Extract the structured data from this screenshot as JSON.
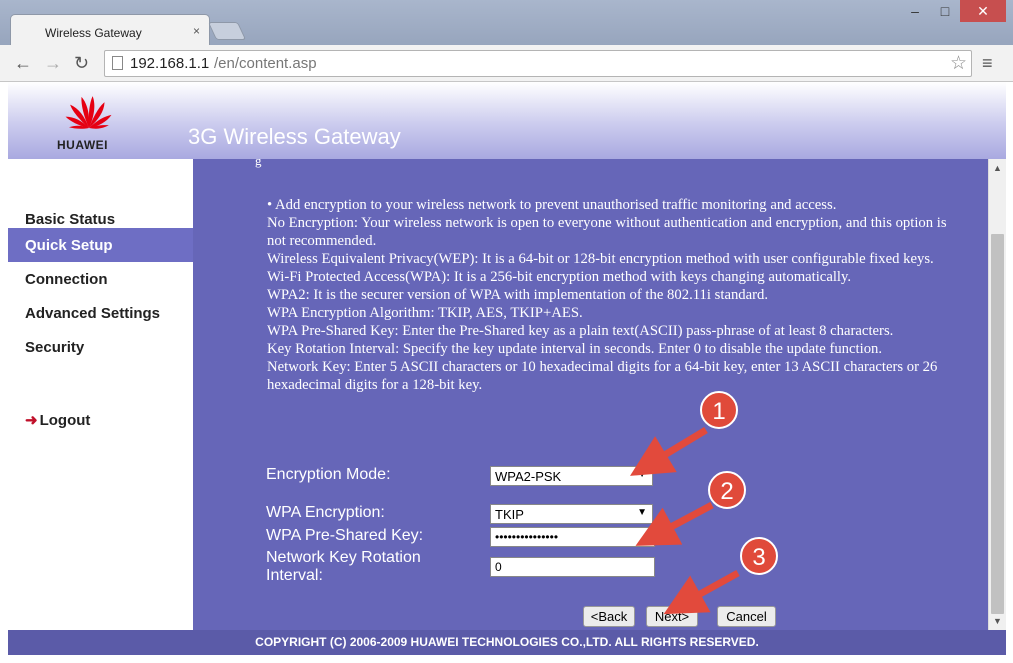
{
  "browser": {
    "tab_title": "Wireless Gateway",
    "tab_close": "×",
    "url_host": "192.168.1.1",
    "url_path": "/en/content.asp",
    "back": "←",
    "forward": "→",
    "reload": "↻",
    "star": "☆",
    "menu": "≡",
    "min": "–",
    "max": "□",
    "close": "✕"
  },
  "header": {
    "brand": "HUAWEI",
    "title": "3G Wireless Gateway",
    "partial_heading": "g"
  },
  "sidebar": {
    "items": [
      {
        "label": "Basic Status"
      },
      {
        "label": "Quick Setup"
      },
      {
        "label": "Connection"
      },
      {
        "label": "Advanced Settings"
      },
      {
        "label": "Security"
      }
    ],
    "logout": "Logout"
  },
  "info": {
    "lines": [
      "• Add encryption to your wireless network to prevent unauthorised traffic monitoring and access.",
      "No Encryption: Your wireless network is open to everyone without authentication and encryption, and this option is not recommended.",
      "Wireless Equivalent Privacy(WEP): It is a 64-bit or 128-bit encryption method with user configurable fixed keys.",
      "Wi-Fi Protected Access(WPA): It is a 256-bit encryption method with keys changing automatically.",
      "WPA2: It is the securer version of WPA with implementation of the 802.11i standard.",
      "WPA Encryption Algorithm: TKIP, AES, TKIP+AES.",
      "WPA Pre-Shared Key: Enter the Pre-Shared key as a plain text(ASCII) pass-phrase of at least 8 characters.",
      "Key Rotation Interval: Specify the key update interval in seconds. Enter 0 to disable the update function.",
      "Network Key: Enter 5 ASCII characters or 10 hexadecimal digits for a 64-bit key, enter 13 ASCII characters or 26 hexadecimal digits for a 128-bit key."
    ]
  },
  "form": {
    "encryption_mode_label": "Encryption Mode:",
    "encryption_mode_value": "WPA2-PSK",
    "wpa_encryption_label": "WPA Encryption:",
    "wpa_encryption_value": "TKIP",
    "psk_label": "WPA Pre-Shared Key:",
    "psk_value": "•••••••••••••••",
    "rotation_label_line1": "Network Key Rotation",
    "rotation_label_line2": "Interval:",
    "rotation_value": "0"
  },
  "buttons": {
    "back": "<Back",
    "next": "Next>",
    "cancel": "Cancel"
  },
  "footer": {
    "copyright": "COPYRIGHT (C) 2006-2009 HUAWEI TECHNOLOGIES CO.,LTD. ALL RIGHTS RESERVED."
  },
  "annotations": {
    "badges": [
      "1",
      "2",
      "3"
    ],
    "badge_color": "#e04a3a",
    "arrow_color": "#e24a3c"
  },
  "colors": {
    "content_bg": "#6666b8",
    "sidebar_active": "#6e6ec4",
    "footer_bg": "#5b5ba8"
  }
}
